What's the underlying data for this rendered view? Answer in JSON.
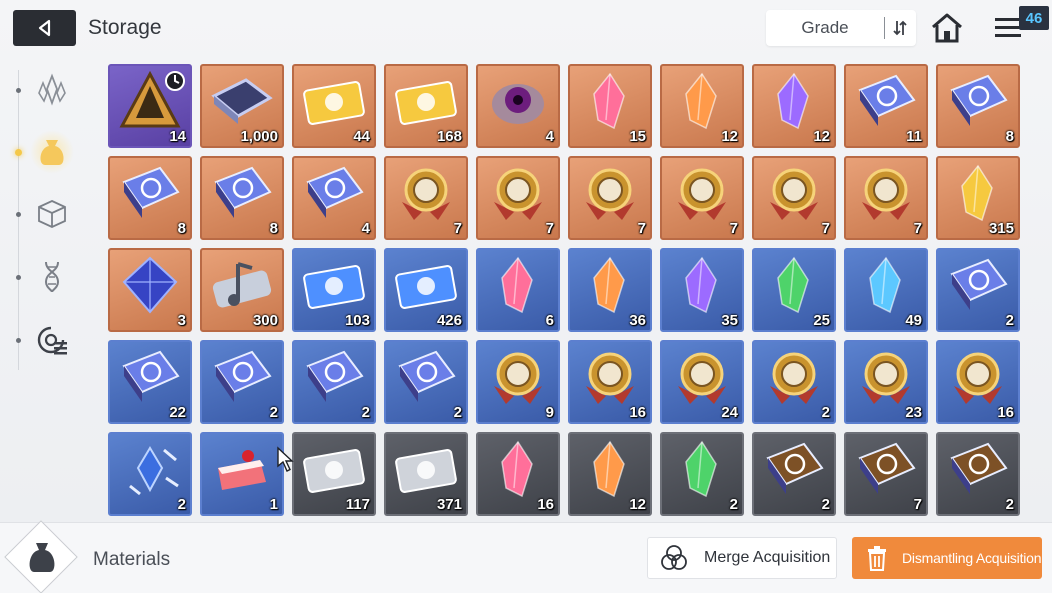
{
  "header": {
    "title": "Storage",
    "sort_label": "Grade",
    "notification_count": "46"
  },
  "sidebar": {
    "items": [
      {
        "name": "crystal-category",
        "icon": "crystal-icon",
        "active": false
      },
      {
        "name": "materials-category",
        "icon": "pouch-icon",
        "active": true
      },
      {
        "name": "cube-category",
        "icon": "cube-icon",
        "active": false
      },
      {
        "name": "dna-category",
        "icon": "dna-icon",
        "active": false
      },
      {
        "name": "module-category",
        "icon": "module-icon",
        "active": false
      }
    ]
  },
  "items": [
    {
      "tier": "purple",
      "art": "pyramid-icon",
      "qty": "14",
      "timer": true
    },
    {
      "tier": "orange",
      "art": "chip-icon",
      "qty": "1,000"
    },
    {
      "tier": "orange",
      "art": "ticket-gold-icon",
      "qty": "44"
    },
    {
      "tier": "orange",
      "art": "ticket-gold-star-icon",
      "qty": "168"
    },
    {
      "tier": "orange",
      "art": "eye-blob-icon",
      "qty": "4"
    },
    {
      "tier": "orange",
      "art": "crystal-pink-icon",
      "qty": "15"
    },
    {
      "tier": "orange",
      "art": "crystal-orange-icon",
      "qty": "12"
    },
    {
      "tier": "orange",
      "art": "crystal-purple-icon",
      "qty": "12"
    },
    {
      "tier": "orange",
      "art": "book-sword-icon",
      "qty": "11"
    },
    {
      "tier": "orange",
      "art": "book-shield-icon",
      "qty": "8"
    },
    {
      "tier": "orange",
      "art": "book-eye-icon",
      "qty": "8"
    },
    {
      "tier": "orange",
      "art": "book-star-icon",
      "qty": "8"
    },
    {
      "tier": "orange",
      "art": "book-slash-icon",
      "qty": "4"
    },
    {
      "tier": "orange",
      "art": "medal-sword-icon",
      "qty": "7"
    },
    {
      "tier": "orange",
      "art": "medal-shield-icon",
      "qty": "7"
    },
    {
      "tier": "orange",
      "art": "medal-square-icon",
      "qty": "7"
    },
    {
      "tier": "orange",
      "art": "medal-star-icon",
      "qty": "7"
    },
    {
      "tier": "orange",
      "art": "medal-bolt-icon",
      "qty": "7"
    },
    {
      "tier": "orange",
      "art": "medal-globe-icon",
      "qty": "7"
    },
    {
      "tier": "orange",
      "art": "shards-gold-icon",
      "qty": "315"
    },
    {
      "tier": "orange",
      "art": "gem-blue-icon",
      "qty": "3"
    },
    {
      "tier": "orange",
      "art": "music-note-icon",
      "qty": "300"
    },
    {
      "tier": "blue",
      "art": "ticket-blue-icon",
      "qty": "103"
    },
    {
      "tier": "blue",
      "art": "ticket-blue-star-icon",
      "qty": "426"
    },
    {
      "tier": "blue",
      "art": "crystal-red-icon",
      "qty": "6"
    },
    {
      "tier": "blue",
      "art": "crystal-orange-icon",
      "qty": "36"
    },
    {
      "tier": "blue",
      "art": "crystal-purple-icon",
      "qty": "35"
    },
    {
      "tier": "blue",
      "art": "crystal-green-icon",
      "qty": "25"
    },
    {
      "tier": "blue",
      "art": "crystal-cyan-icon",
      "qty": "49"
    },
    {
      "tier": "blue",
      "art": "book-sword-icon",
      "qty": "2"
    },
    {
      "tier": "blue",
      "art": "book-eye-icon",
      "qty": "22"
    },
    {
      "tier": "blue",
      "art": "book-star-icon",
      "qty": "2"
    },
    {
      "tier": "blue",
      "art": "book-slash-icon",
      "qty": "2"
    },
    {
      "tier": "blue",
      "art": "book-globe-icon",
      "qty": "2"
    },
    {
      "tier": "blue",
      "art": "medal-sword-icon",
      "qty": "9"
    },
    {
      "tier": "blue",
      "art": "medal-shield-icon",
      "qty": "16"
    },
    {
      "tier": "blue",
      "art": "medal-square-icon",
      "qty": "24"
    },
    {
      "tier": "blue",
      "art": "medal-star-icon",
      "qty": "2"
    },
    {
      "tier": "blue",
      "art": "medal-bolt-icon",
      "qty": "23"
    },
    {
      "tier": "blue",
      "art": "medal-globe-icon",
      "qty": "16"
    },
    {
      "tier": "blue",
      "art": "feather-gem-icon",
      "qty": "2"
    },
    {
      "tier": "blue",
      "art": "cake-icon",
      "qty": "1"
    },
    {
      "tier": "gray",
      "art": "ticket-silver-icon",
      "qty": "117"
    },
    {
      "tier": "gray",
      "art": "ticket-silver-star-icon",
      "qty": "371"
    },
    {
      "tier": "gray",
      "art": "crystal-red-icon",
      "qty": "16"
    },
    {
      "tier": "gray",
      "art": "crystal-orange-icon",
      "qty": "12"
    },
    {
      "tier": "gray",
      "art": "crystal-green-icon",
      "qty": "2"
    },
    {
      "tier": "gray",
      "art": "book-brown-sword-icon",
      "qty": "2"
    },
    {
      "tier": "gray",
      "art": "book-brown-shield-icon",
      "qty": "7"
    },
    {
      "tier": "gray",
      "art": "book-brown-eye-icon",
      "qty": "2"
    }
  ],
  "footer": {
    "category_label": "Materials",
    "category_icon": "pouch-icon",
    "merge_label": "Merge Acquisition",
    "dismantle_label": "Dismantling Acquisition"
  },
  "colors": {
    "accent": "#f08a3c",
    "orange_tier": "#d8895e",
    "blue_tier": "#4a6dbb",
    "purple_tier": "#6a52b6",
    "gray_tier": "#4e5158",
    "badge_text": "#59c6ff"
  }
}
